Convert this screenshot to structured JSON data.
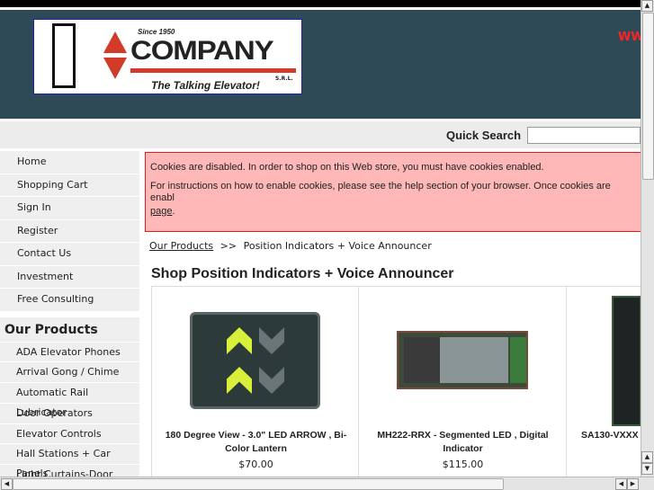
{
  "header": {
    "logo": {
      "since": "Since 1950",
      "name": "COMPANY",
      "tagline": "The Talking Elevator!",
      "suffix": "S.R.L."
    },
    "url_fragment": "WW"
  },
  "search": {
    "label": "Quick Search",
    "value": ""
  },
  "sidebar": {
    "items": [
      {
        "label": "Home"
      },
      {
        "label": "Shopping Cart"
      },
      {
        "label": "Sign In"
      },
      {
        "label": "Register"
      },
      {
        "label": "Contact Us"
      },
      {
        "label": "Investment"
      },
      {
        "label": "Free Consulting"
      }
    ],
    "products_heading": "Our Products",
    "products": [
      {
        "label": "ADA Elevator Phones"
      },
      {
        "label": "Arrival Gong / Chime"
      },
      {
        "label": "Automatic Rail Lubricator"
      },
      {
        "label": "Door Operators"
      },
      {
        "label": "Elevator Controls"
      },
      {
        "label": "Hall Stations + Car Panels"
      },
      {
        "label": "Light Curtains-Door"
      }
    ]
  },
  "alert": {
    "line1": "Cookies are disabled. In order to shop on this Web store, you must have cookies enabled.",
    "line2": "For instructions on how to enable cookies, please see the help section of your browser. Once cookies are enabl",
    "link": "page",
    "link_suffix": "."
  },
  "breadcrumb": {
    "root": "Our Products",
    "separator": ">>",
    "current": "Position Indicators + Voice Announcer"
  },
  "page_title": "Shop Position Indicators + Voice Announcer",
  "products": [
    {
      "name": "180 Degree View - 3.0\" LED ARROW , Bi-Color Lantern",
      "price": "$70.00"
    },
    {
      "name": "MH222-RRX - Segmented LED , Digital Indicator",
      "price": "$115.00"
    },
    {
      "name": "SA130-VXXX -",
      "price": ""
    }
  ]
}
